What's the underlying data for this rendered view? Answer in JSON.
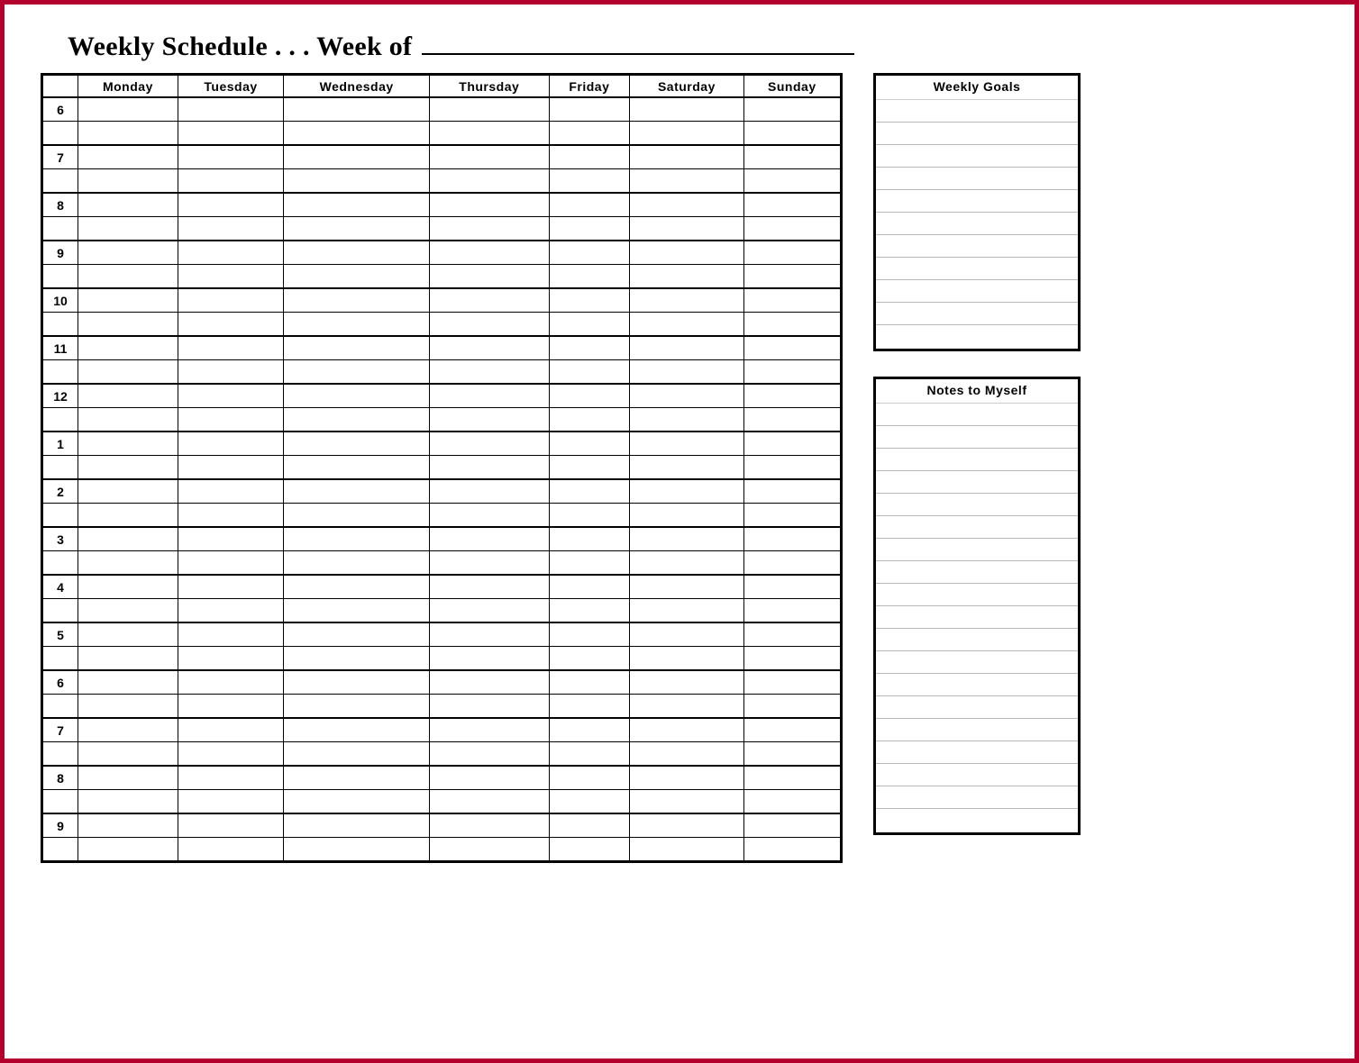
{
  "title": {
    "prefix": "Weekly Schedule . . . Week of",
    "value": ""
  },
  "schedule": {
    "days": [
      "Monday",
      "Tuesday",
      "Wednesday",
      "Thursday",
      "Friday",
      "Saturday",
      "Sunday"
    ],
    "hours": [
      "6",
      "7",
      "8",
      "9",
      "10",
      "11",
      "12",
      "1",
      "2",
      "3",
      "4",
      "5",
      "6",
      "7",
      "8",
      "9"
    ],
    "half_rows_per_hour": 2
  },
  "sidebar": {
    "goals": {
      "title": "Weekly Goals",
      "lines": [
        "",
        "",
        "",
        "",
        "",
        "",
        "",
        "",
        "",
        "",
        ""
      ]
    },
    "notes": {
      "title": "Notes to Myself",
      "lines": [
        "",
        "",
        "",
        "",
        "",
        "",
        "",
        "",
        "",
        "",
        "",
        "",
        "",
        "",
        "",
        "",
        "",
        "",
        ""
      ]
    }
  }
}
